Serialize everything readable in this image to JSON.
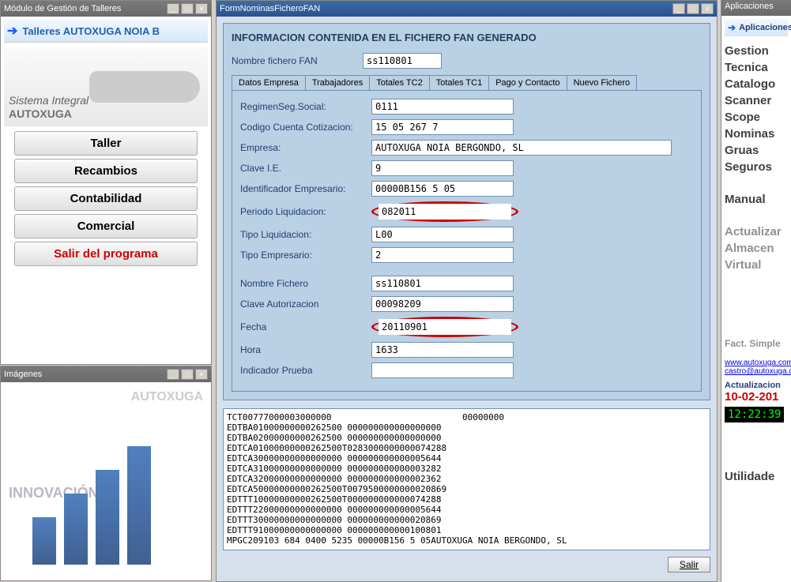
{
  "left": {
    "title": "Módulo de Gestión de Talleres",
    "header": "Talleres AUTOXUGA NOIA B",
    "sistema": "Sistema Integral",
    "autoxuga": "AUTOXUGA",
    "buttons": [
      "Taller",
      "Recambios",
      "Contabilidad",
      "Comercial",
      "Salir del programa"
    ]
  },
  "images": {
    "title": "Imágenes",
    "wm1": "AUTOXUGA",
    "wm2": "INNOVACIÓN"
  },
  "center": {
    "title": "FormNominasFicheroFAN",
    "panel_title": "INFORMACION CONTENIDA EN EL FICHERO FAN GENERADO",
    "nombre_label": "Nombre fichero FAN",
    "nombre_value": "ss110801",
    "tabs": [
      "Datos Empresa",
      "Trabajadores",
      "Totales TC2",
      "Totales TC1",
      "Pago y Contacto",
      "Nuevo Fichero"
    ],
    "fields": {
      "regimen_l": "RegimenSeg.Social:",
      "regimen_v": "0111",
      "codigo_l": "Codigo Cuenta Cotizacion:",
      "codigo_v": "15 05 267 7",
      "empresa_l": "Empresa:",
      "empresa_v": "AUTOXUGA NOIA BERGONDO, SL",
      "clave_l": "Clave I.E.",
      "clave_v": "9",
      "ident_l": "Identificador Empresario:",
      "ident_v": "00000B156 5 05",
      "periodo_l": "Periodo Liquidacion:",
      "periodo_v": "082011",
      "tipoliq_l": "Tipo Liquidacion:",
      "tipoliq_v": "L00",
      "tipoemp_l": "Tipo Empresario:",
      "tipoemp_v": "2",
      "nomfic_l": "Nombre Fichero",
      "nomfic_v": "ss110801",
      "claveaut_l": "Clave Autorizacion",
      "claveaut_v": "00098209",
      "fecha_l": "Fecha",
      "fecha_v": "20110901",
      "hora_l": "Hora",
      "hora_v": "1633",
      "indprueba_l": "Indicador Prueba",
      "indprueba_v": ""
    },
    "raw": "TCT00777000003000000                         00000000\nEDTBA01000000000262500 000000000000000000\nEDTBA02000000000262500 000000000000000000\nEDTCA01000000000262500T0283000000000074288\nEDTCA30000000000000000 000000000000005644\nEDTCA31000000000000000 000000000000003282\nEDTCA32000000000000000 000000000000002362\nEDTCA50000000000262500T0079500000000020869\nEDTTT10000000000262500T000000000000074288\nEDTTT22000000000000000 000000000000005644\nEDTTT30000000000000000 000000000000020869\nEDTTT91000000000000000 000000000000100801\nMPGC209103 684 0400 5235 00000B156 5 05AUTOXUGA NOIA BERGONDO, SL",
    "salir": "Salir"
  },
  "right": {
    "title": "Aplicaciones",
    "apps_header": "Aplicaciones",
    "items": [
      "Gestion",
      "Tecnica",
      "Catalogo",
      "Scanner",
      "Scope",
      "Nominas",
      "Gruas",
      "Seguros"
    ],
    "manual": "Manual",
    "grey_items": [
      "Actualizar",
      "Almacen",
      "Virtual"
    ],
    "fact": "Fact. Simple",
    "link1": "www.autoxuga.com",
    "link2": "castro@autoxuga.com",
    "act_label": "Actualizacion",
    "act_date": "10-02-201",
    "clock": "12:22:39",
    "util": "Utilidade"
  }
}
